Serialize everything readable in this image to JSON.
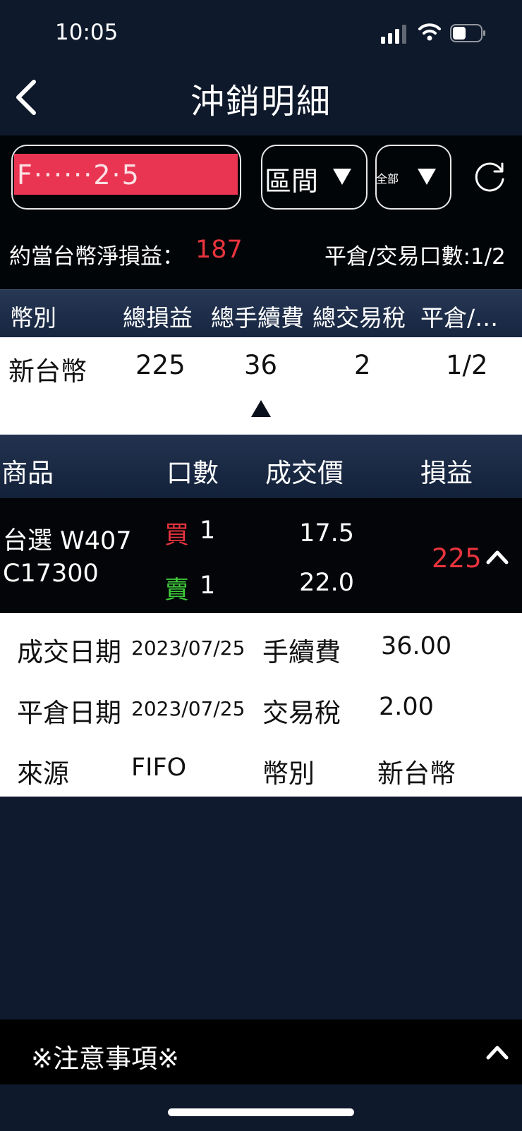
{
  "status_bar": {
    "time": "10:05",
    "icons": [
      "cellular-signal-icon",
      "wifi-icon",
      "battery-icon"
    ]
  },
  "nav": {
    "title": "沖銷明細",
    "back_icon": "chevron-left-icon"
  },
  "filters": {
    "account_value": "F······2·5",
    "period_label": "區間",
    "type_label": "全部",
    "dropdown_icon": "triangle-down-icon",
    "refresh_icon": "refresh-icon"
  },
  "summary_line": {
    "net_label": "約當台幣淨損益：",
    "net_value": "187",
    "lots_label": "平倉/交易口數:1/2"
  },
  "summary_table": {
    "headers": [
      "幣別",
      "總損益",
      "總手續費",
      "總交易稅",
      "平倉/…"
    ],
    "row": [
      "新台幣",
      "225",
      "36",
      "2",
      "1/2"
    ],
    "collapse_icon": "triangle-up-icon"
  },
  "detail_table": {
    "headers": [
      "商品",
      "口數",
      "成交價",
      "損益"
    ],
    "rows": [
      {
        "product": "台選 W407 C17300",
        "buy_label": "買",
        "buy_qty": "1",
        "buy_price": "17.5",
        "sell_label": "賣",
        "sell_qty": "1",
        "sell_price": "22.0",
        "pl": "225",
        "expand_icon": "chevron-up-icon"
      }
    ]
  },
  "detail_expanded": {
    "trade_date_label": "成交日期",
    "trade_date": "2023/07/25",
    "fee_label": "手續費",
    "fee": "36.00",
    "close_date_label": "平倉日期",
    "close_date": "2023/07/25",
    "tax_label": "交易稅",
    "tax": "2.00",
    "source_label": "來源",
    "source": "FIFO",
    "currency_label": "幣別",
    "currency": "新台幣"
  },
  "footer": {
    "notice_label": "※注意事項※",
    "notice_icon": "chevron-up-icon"
  },
  "colors": {
    "background": "#0f1a2e",
    "profit_red": "#e8343d",
    "sell_green": "#3fcb3b",
    "redaction": "#ea3552"
  }
}
